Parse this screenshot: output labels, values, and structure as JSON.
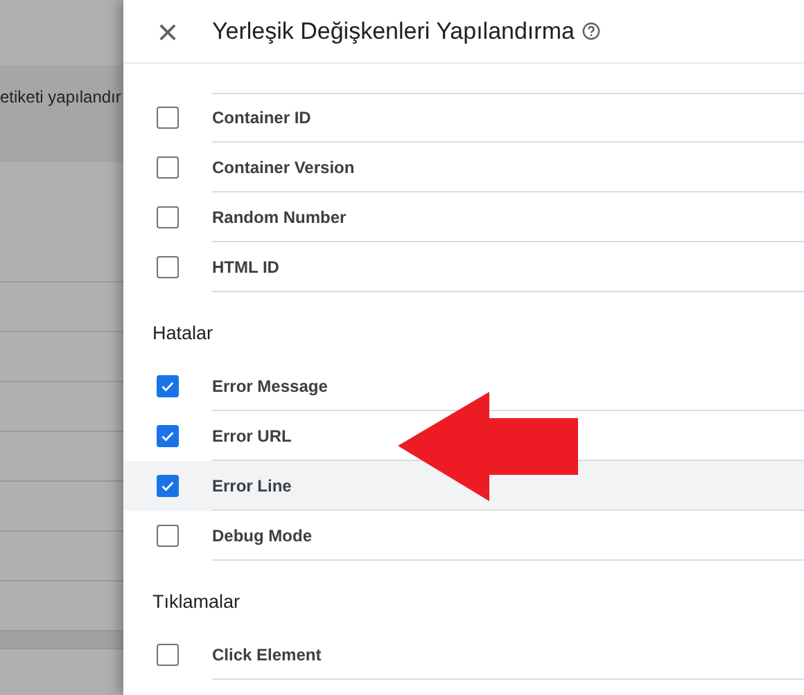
{
  "background": {
    "row_text": "etiketi yapılandır"
  },
  "dialog": {
    "close": "×",
    "title": "Yerleşik Değişkenleri Yapılandırma"
  },
  "sections": [
    {
      "items": [
        {
          "label": "Container ID",
          "checked": false,
          "highlighted": false
        },
        {
          "label": "Container Version",
          "checked": false,
          "highlighted": false
        },
        {
          "label": "Random Number",
          "checked": false,
          "highlighted": false
        },
        {
          "label": "HTML ID",
          "checked": false,
          "highlighted": false
        }
      ]
    },
    {
      "heading": "Hatalar",
      "items": [
        {
          "label": "Error Message",
          "checked": true,
          "highlighted": false
        },
        {
          "label": "Error URL",
          "checked": true,
          "highlighted": false
        },
        {
          "label": "Error Line",
          "checked": true,
          "highlighted": true
        },
        {
          "label": "Debug Mode",
          "checked": false,
          "highlighted": false
        }
      ]
    },
    {
      "heading": "Tıklamalar",
      "items": [
        {
          "label": "Click Element",
          "checked": false,
          "highlighted": false
        }
      ]
    }
  ]
}
